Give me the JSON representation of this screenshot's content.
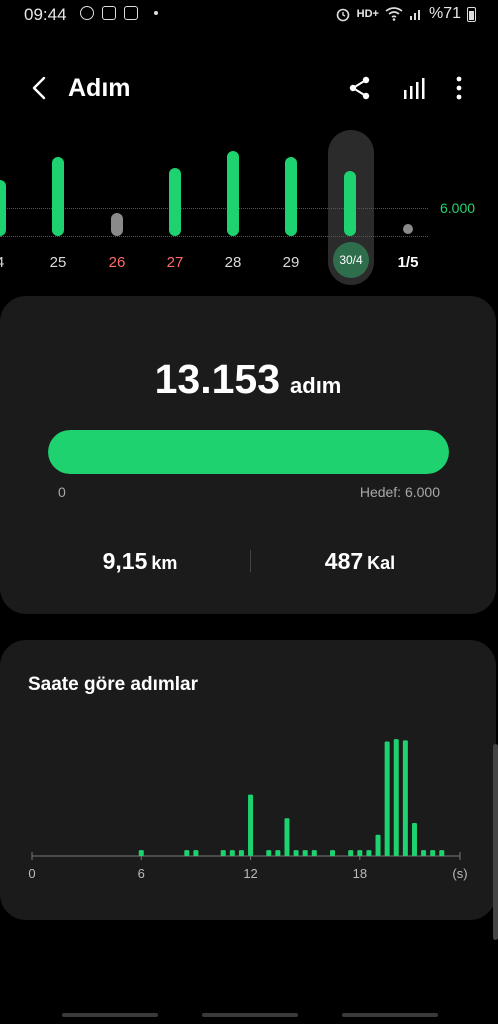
{
  "status_bar": {
    "time": "09:44",
    "left_icons": [
      "whatsapp-icon",
      "image-icon",
      "camera-icon"
    ],
    "right_text_hd": "HD+",
    "battery": "%71"
  },
  "header": {
    "title": "Adım",
    "actions": [
      "share-icon",
      "stats-icon",
      "more-icon"
    ]
  },
  "day_strip": {
    "goal_label": "6.000",
    "goal": 6000,
    "selected_day": "30/4",
    "days": [
      {
        "label": "4",
        "level": 0.66,
        "type": "bar"
      },
      {
        "label": "25",
        "level": 0.93,
        "type": "bar"
      },
      {
        "label": "26",
        "level": 0.27,
        "type": "gray",
        "weekend": true
      },
      {
        "label": "27",
        "level": 0.8,
        "type": "bar",
        "weekend": true
      },
      {
        "label": "28",
        "level": 1.0,
        "type": "bar"
      },
      {
        "label": "29",
        "level": 0.93,
        "type": "bar"
      },
      {
        "label": "30/4",
        "level": 0.77,
        "type": "bar",
        "selected": true
      },
      {
        "label": "1/5",
        "level": 0,
        "type": "dot",
        "bold": true
      }
    ]
  },
  "summary": {
    "steps": "13.153",
    "steps_unit": "adım",
    "progress_fraction": 1.0,
    "progress_min": "0",
    "progress_goal_label": "Hedef: 6.000",
    "distance_value": "9,15",
    "distance_unit": "km",
    "calories_value": "487",
    "calories_unit": "Kal"
  },
  "hourly": {
    "title": "Saate göre adımlar",
    "axis_labels": [
      "0",
      "6",
      "12",
      "18",
      "(s)"
    ],
    "axis_hours": [
      0,
      6,
      12,
      18,
      23.5
    ],
    "bars": [
      {
        "h": 6,
        "v": 0.05
      },
      {
        "h": 8.5,
        "v": 0.05
      },
      {
        "h": 9,
        "v": 0.05
      },
      {
        "h": 10.5,
        "v": 0.05
      },
      {
        "h": 11,
        "v": 0.05
      },
      {
        "h": 11.5,
        "v": 0.05
      },
      {
        "h": 12,
        "v": 0.52
      },
      {
        "h": 13,
        "v": 0.05
      },
      {
        "h": 13.5,
        "v": 0.05
      },
      {
        "h": 14,
        "v": 0.32
      },
      {
        "h": 14.5,
        "v": 0.05
      },
      {
        "h": 15,
        "v": 0.05
      },
      {
        "h": 15.5,
        "v": 0.05
      },
      {
        "h": 16.5,
        "v": 0.05
      },
      {
        "h": 17.5,
        "v": 0.05
      },
      {
        "h": 18,
        "v": 0.05
      },
      {
        "h": 18.5,
        "v": 0.05
      },
      {
        "h": 19,
        "v": 0.18
      },
      {
        "h": 19.5,
        "v": 0.97
      },
      {
        "h": 20,
        "v": 0.99
      },
      {
        "h": 20.5,
        "v": 0.98
      },
      {
        "h": 21,
        "v": 0.28
      },
      {
        "h": 21.5,
        "v": 0.05
      },
      {
        "h": 22,
        "v": 0.05
      },
      {
        "h": 22.5,
        "v": 0.05
      }
    ]
  },
  "colors": {
    "accent": "#1ed36f",
    "weekend": "#ff6b6b",
    "card": "#1b1b1b"
  }
}
